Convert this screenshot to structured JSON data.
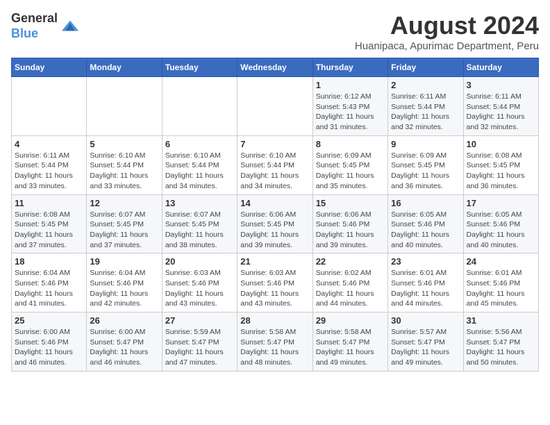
{
  "header": {
    "logo": {
      "line1": "General",
      "line2": "Blue"
    },
    "title": "August 2024",
    "subtitle": "Huanipaca, Apurimac Department, Peru"
  },
  "weekdays": [
    "Sunday",
    "Monday",
    "Tuesday",
    "Wednesday",
    "Thursday",
    "Friday",
    "Saturday"
  ],
  "weeks": [
    [
      {
        "day": "",
        "info": ""
      },
      {
        "day": "",
        "info": ""
      },
      {
        "day": "",
        "info": ""
      },
      {
        "day": "",
        "info": ""
      },
      {
        "day": "1",
        "info": "Sunrise: 6:12 AM\nSunset: 5:43 PM\nDaylight: 11 hours and 31 minutes."
      },
      {
        "day": "2",
        "info": "Sunrise: 6:11 AM\nSunset: 5:44 PM\nDaylight: 11 hours and 32 minutes."
      },
      {
        "day": "3",
        "info": "Sunrise: 6:11 AM\nSunset: 5:44 PM\nDaylight: 11 hours and 32 minutes."
      }
    ],
    [
      {
        "day": "4",
        "info": "Sunrise: 6:11 AM\nSunset: 5:44 PM\nDaylight: 11 hours and 33 minutes."
      },
      {
        "day": "5",
        "info": "Sunrise: 6:10 AM\nSunset: 5:44 PM\nDaylight: 11 hours and 33 minutes."
      },
      {
        "day": "6",
        "info": "Sunrise: 6:10 AM\nSunset: 5:44 PM\nDaylight: 11 hours and 34 minutes."
      },
      {
        "day": "7",
        "info": "Sunrise: 6:10 AM\nSunset: 5:44 PM\nDaylight: 11 hours and 34 minutes."
      },
      {
        "day": "8",
        "info": "Sunrise: 6:09 AM\nSunset: 5:45 PM\nDaylight: 11 hours and 35 minutes."
      },
      {
        "day": "9",
        "info": "Sunrise: 6:09 AM\nSunset: 5:45 PM\nDaylight: 11 hours and 36 minutes."
      },
      {
        "day": "10",
        "info": "Sunrise: 6:08 AM\nSunset: 5:45 PM\nDaylight: 11 hours and 36 minutes."
      }
    ],
    [
      {
        "day": "11",
        "info": "Sunrise: 6:08 AM\nSunset: 5:45 PM\nDaylight: 11 hours and 37 minutes."
      },
      {
        "day": "12",
        "info": "Sunrise: 6:07 AM\nSunset: 5:45 PM\nDaylight: 11 hours and 37 minutes."
      },
      {
        "day": "13",
        "info": "Sunrise: 6:07 AM\nSunset: 5:45 PM\nDaylight: 11 hours and 38 minutes."
      },
      {
        "day": "14",
        "info": "Sunrise: 6:06 AM\nSunset: 5:45 PM\nDaylight: 11 hours and 39 minutes."
      },
      {
        "day": "15",
        "info": "Sunrise: 6:06 AM\nSunset: 5:46 PM\nDaylight: 11 hours and 39 minutes."
      },
      {
        "day": "16",
        "info": "Sunrise: 6:05 AM\nSunset: 5:46 PM\nDaylight: 11 hours and 40 minutes."
      },
      {
        "day": "17",
        "info": "Sunrise: 6:05 AM\nSunset: 5:46 PM\nDaylight: 11 hours and 40 minutes."
      }
    ],
    [
      {
        "day": "18",
        "info": "Sunrise: 6:04 AM\nSunset: 5:46 PM\nDaylight: 11 hours and 41 minutes."
      },
      {
        "day": "19",
        "info": "Sunrise: 6:04 AM\nSunset: 5:46 PM\nDaylight: 11 hours and 42 minutes."
      },
      {
        "day": "20",
        "info": "Sunrise: 6:03 AM\nSunset: 5:46 PM\nDaylight: 11 hours and 43 minutes."
      },
      {
        "day": "21",
        "info": "Sunrise: 6:03 AM\nSunset: 5:46 PM\nDaylight: 11 hours and 43 minutes."
      },
      {
        "day": "22",
        "info": "Sunrise: 6:02 AM\nSunset: 5:46 PM\nDaylight: 11 hours and 44 minutes."
      },
      {
        "day": "23",
        "info": "Sunrise: 6:01 AM\nSunset: 5:46 PM\nDaylight: 11 hours and 44 minutes."
      },
      {
        "day": "24",
        "info": "Sunrise: 6:01 AM\nSunset: 5:46 PM\nDaylight: 11 hours and 45 minutes."
      }
    ],
    [
      {
        "day": "25",
        "info": "Sunrise: 6:00 AM\nSunset: 5:46 PM\nDaylight: 11 hours and 46 minutes."
      },
      {
        "day": "26",
        "info": "Sunrise: 6:00 AM\nSunset: 5:47 PM\nDaylight: 11 hours and 46 minutes."
      },
      {
        "day": "27",
        "info": "Sunrise: 5:59 AM\nSunset: 5:47 PM\nDaylight: 11 hours and 47 minutes."
      },
      {
        "day": "28",
        "info": "Sunrise: 5:58 AM\nSunset: 5:47 PM\nDaylight: 11 hours and 48 minutes."
      },
      {
        "day": "29",
        "info": "Sunrise: 5:58 AM\nSunset: 5:47 PM\nDaylight: 11 hours and 49 minutes."
      },
      {
        "day": "30",
        "info": "Sunrise: 5:57 AM\nSunset: 5:47 PM\nDaylight: 11 hours and 49 minutes."
      },
      {
        "day": "31",
        "info": "Sunrise: 5:56 AM\nSunset: 5:47 PM\nDaylight: 11 hours and 50 minutes."
      }
    ]
  ]
}
